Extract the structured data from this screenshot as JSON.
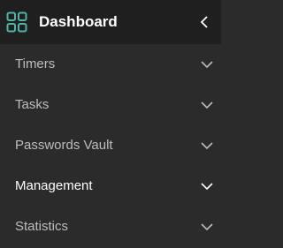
{
  "header": {
    "title": "Dashboard",
    "logo_icon": "grid-icon",
    "collapse_icon": "chevron-left-icon"
  },
  "menu": {
    "items": [
      {
        "label": "Timers",
        "expanded": false,
        "active": false
      },
      {
        "label": "Tasks",
        "expanded": false,
        "active": false
      },
      {
        "label": "Passwords Vault",
        "expanded": false,
        "active": false
      },
      {
        "label": "Management",
        "expanded": false,
        "active": true
      },
      {
        "label": "Statistics",
        "expanded": false,
        "active": false
      }
    ]
  },
  "colors": {
    "background": "#2b2b2b",
    "header_background": "#1f1f1f",
    "accent": "#4fb3a6",
    "text": "#bdbdbd",
    "text_active": "#ffffff"
  }
}
